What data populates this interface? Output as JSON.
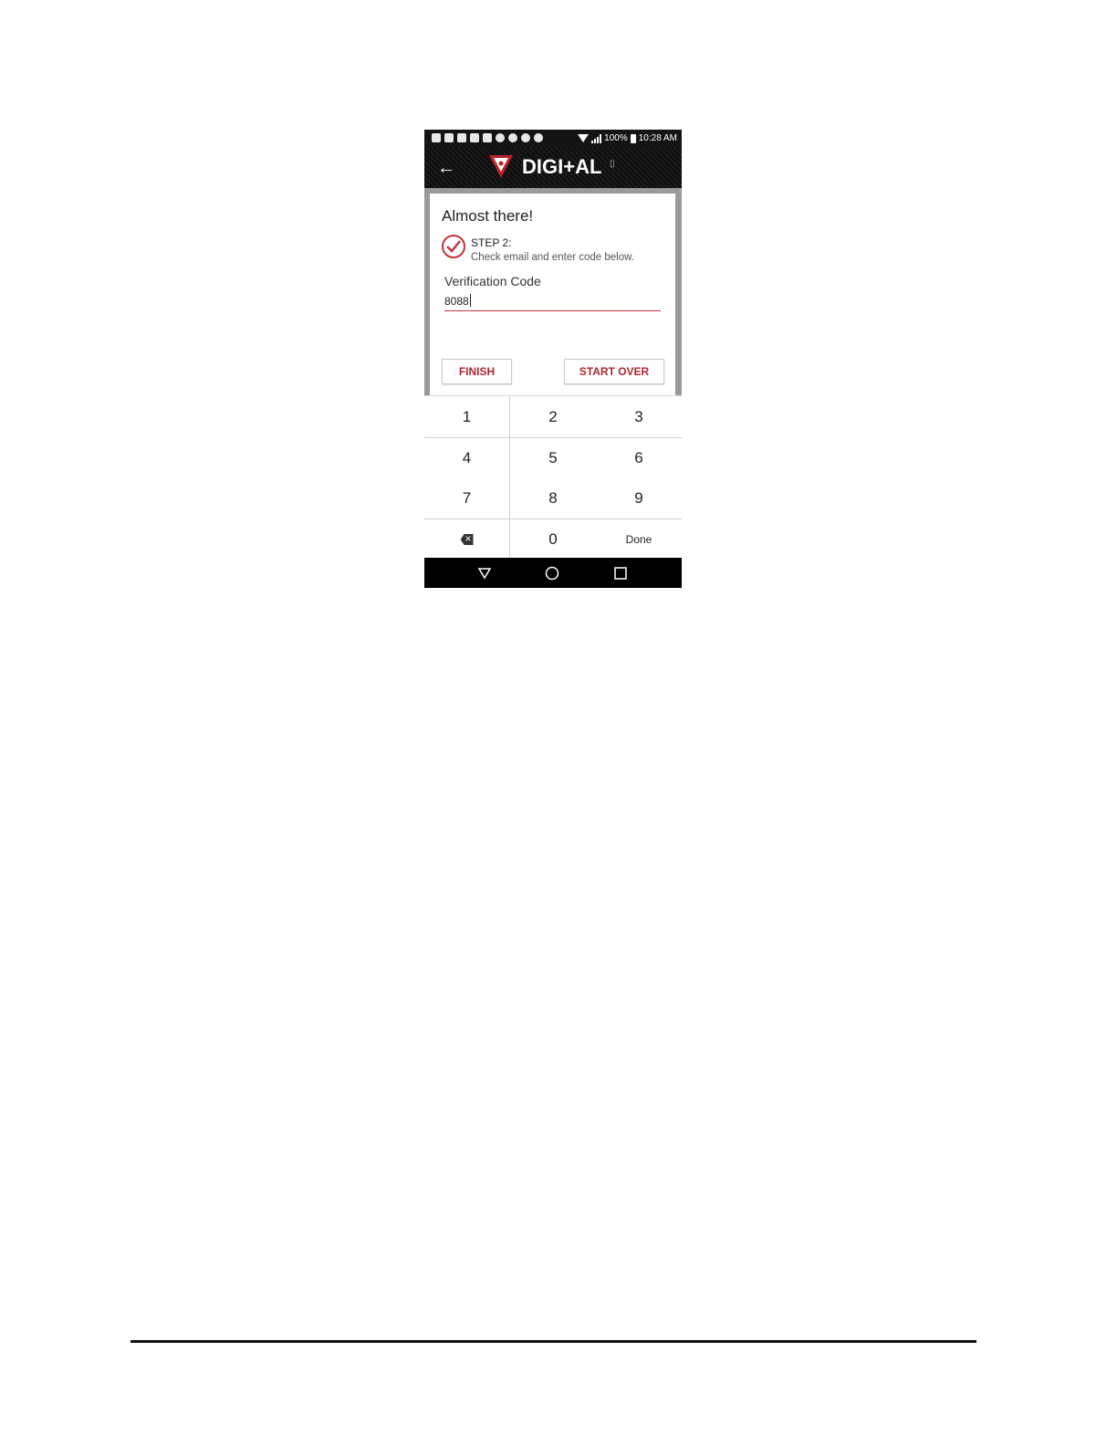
{
  "status_bar": {
    "battery": "100%",
    "time": "10:28 AM"
  },
  "app_bar": {
    "brand_name": "DIGI+AL",
    "logo_icon": "guess-triangle-logo-icon",
    "back_icon": "back-arrow-icon"
  },
  "card": {
    "title": "Almost there!",
    "step_label": "STEP 2:",
    "step_description": "Check email and enter code below.",
    "field_label": "Verification Code",
    "field_value": "8088",
    "finish_label": "FINISH",
    "start_over_label": "START OVER"
  },
  "keypad": {
    "keys": [
      "1",
      "2",
      "3",
      "4",
      "5",
      "6",
      "7",
      "8",
      "9",
      "0"
    ],
    "done_label": "Done",
    "backspace_icon": "backspace-icon"
  },
  "nav_bar": {
    "icons": [
      "triangle-back-icon",
      "circle-home-icon",
      "square-recents-icon"
    ]
  },
  "colors": {
    "accent": "#b0262f",
    "app_bar": "#141414",
    "nav_bar": "#000000"
  }
}
